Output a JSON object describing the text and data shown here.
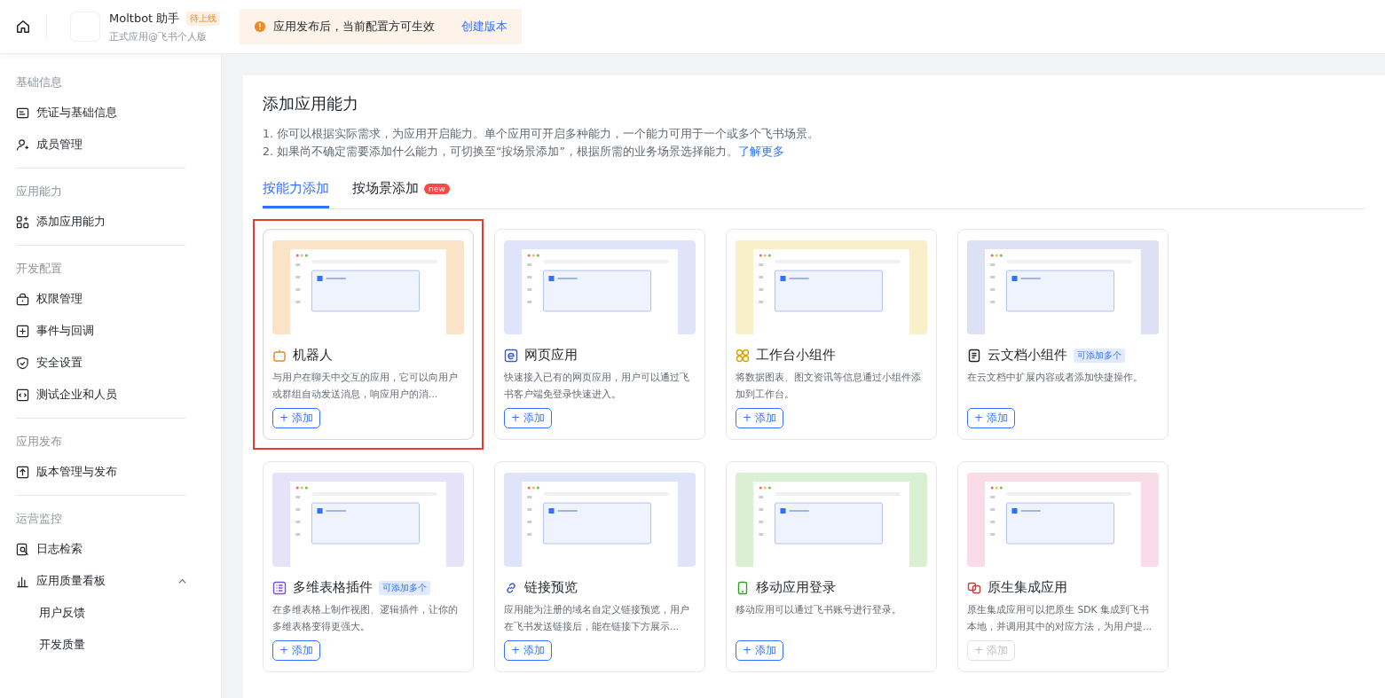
{
  "header": {
    "app_name": "Moltbot 助手",
    "status_tag": "待上线",
    "app_subtitle": "正式应用@飞书个人版",
    "notice": {
      "text": "应用发布后，当前配置方可生效",
      "link": "创建版本"
    }
  },
  "sidebar": {
    "sections": [
      {
        "title": "基础信息",
        "items": [
          {
            "label": "凭证与基础信息"
          },
          {
            "label": "成员管理"
          }
        ]
      },
      {
        "title": "应用能力",
        "items": [
          {
            "label": "添加应用能力"
          }
        ]
      },
      {
        "title": "开发配置",
        "items": [
          {
            "label": "权限管理"
          },
          {
            "label": "事件与回调"
          },
          {
            "label": "安全设置"
          },
          {
            "label": "测试企业和人员"
          }
        ]
      },
      {
        "title": "应用发布",
        "items": [
          {
            "label": "版本管理与发布"
          }
        ]
      },
      {
        "title": "运营监控",
        "items": [
          {
            "label": "日志检索"
          },
          {
            "label": "应用质量看板",
            "expanded": true,
            "children": [
              {
                "label": "用户反馈"
              },
              {
                "label": "开发质量"
              }
            ]
          }
        ]
      }
    ]
  },
  "main": {
    "title": "添加应用能力",
    "notes": [
      "1. 你可以根据实际需求，为应用开启能力。单个应用可开启多种能力，一个能力可用于一个或多个飞书场景。",
      "2. 如果尚不确定需要添加什么能力，可切换至“按场景添加”，根据所需的业务场景选择能力。"
    ],
    "learn_more": "了解更多",
    "tabs": [
      {
        "label": "按能力添加",
        "selected": true
      },
      {
        "label": "按场景添加",
        "selected": false,
        "badge": "new"
      }
    ],
    "cards": [
      {
        "title": "机器人",
        "description": "与用户在聊天中交互的应用，它可以向用户或群组自动发送消息，响应用户的消...",
        "button": "+ 添加",
        "disabled": false,
        "highlighted": true,
        "color": "#fbe3c8"
      },
      {
        "title": "网页应用",
        "description": "快速接入已有的网页应用，用户可以通过飞书客户端免登录快速进入。",
        "button": "+ 添加",
        "disabled": false,
        "highlighted": false,
        "color": "#dfe4fa"
      },
      {
        "title": "工作台小组件",
        "description": "将数据图表、图文资讯等信息通过小组件添加到工作台。",
        "button": "+ 添加",
        "disabled": false,
        "highlighted": false,
        "color": "#f9efc8"
      },
      {
        "title": "云文档小组件",
        "badge": "可添加多个",
        "description": "在云文档中扩展内容或者添加快捷操作。",
        "button": "+ 添加",
        "disabled": false,
        "highlighted": false,
        "color": "#dde1f3"
      },
      {
        "title": "多维表格插件",
        "badge": "可添加多个",
        "description": "在多维表格上制作视图、逻辑插件，让你的多维表格变得更强大。",
        "button": "+ 添加",
        "disabled": false,
        "highlighted": false,
        "color": "#e6e3f8"
      },
      {
        "title": "链接预览",
        "description": "应用能为注册的域名自定义链接预览，用户在飞书发送链接后，能在链接下方展示...",
        "button": "+ 添加",
        "disabled": false,
        "highlighted": false,
        "color": "#dfe4fa"
      },
      {
        "title": "移动应用登录",
        "description": "移动应用可以通过飞书账号进行登录。",
        "button": "+ 添加",
        "disabled": false,
        "highlighted": false,
        "color": "#d9f0d3"
      },
      {
        "title": "原生集成应用",
        "description": "原生集成应用可以把原生 SDK 集成到飞书本地，并调用其中的对应方法，为用户提...",
        "button": "+ 添加",
        "disabled": true,
        "highlighted": false,
        "color": "#fadbe8"
      }
    ]
  }
}
